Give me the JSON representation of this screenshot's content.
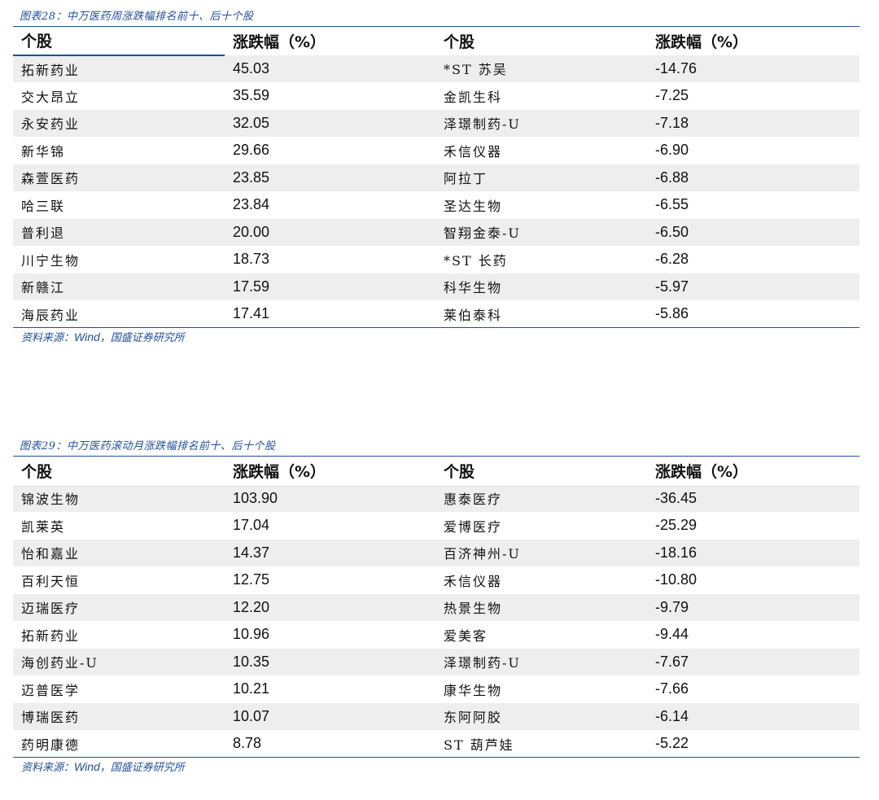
{
  "tables": [
    {
      "title": "图表28：中万医药周涨跌幅排名前十、后十个股",
      "headers": [
        "个股",
        "涨跌幅（%）",
        "个股",
        "涨跌幅（%）"
      ],
      "rows": [
        [
          "拓新药业",
          "45.03",
          "*ST 苏吴",
          "-14.76"
        ],
        [
          "交大昂立",
          "35.59",
          "金凯生科",
          "-7.25"
        ],
        [
          "永安药业",
          "32.05",
          "泽璟制药-U",
          "-7.18"
        ],
        [
          "新华锦",
          "29.66",
          "禾信仪器",
          "-6.90"
        ],
        [
          "森萱医药",
          "23.85",
          "阿拉丁",
          "-6.88"
        ],
        [
          "哈三联",
          "23.84",
          "圣达生物",
          "-6.55"
        ],
        [
          "普利退",
          "20.00",
          "智翔金泰-U",
          "-6.50"
        ],
        [
          "川宁生物",
          "18.73",
          "*ST 长药",
          "-6.28"
        ],
        [
          "新赣江",
          "17.59",
          "科华生物",
          "-5.97"
        ],
        [
          "海辰药业",
          "17.41",
          "莱伯泰科",
          "-5.86"
        ]
      ],
      "source_prefix": "资料来源：",
      "source_wind": "Wind",
      "source_suffix": "，国盛证券研究所"
    },
    {
      "title": "图表29：中万医药滚动月涨跌幅排名前十、后十个股",
      "headers": [
        "个股",
        "涨跌幅（%）",
        "个股",
        "涨跌幅（%）"
      ],
      "rows": [
        [
          "锦波生物",
          "103.90",
          "惠泰医疗",
          "-36.45"
        ],
        [
          "凯莱英",
          "17.04",
          "爱博医疗",
          "-25.29"
        ],
        [
          "怡和嘉业",
          "14.37",
          "百济神州-U",
          "-18.16"
        ],
        [
          "百利天恒",
          "12.75",
          "禾信仪器",
          "-10.80"
        ],
        [
          "迈瑞医疗",
          "12.20",
          "热景生物",
          "-9.79"
        ],
        [
          "拓新药业",
          "10.96",
          "爱美客",
          "-9.44"
        ],
        [
          "海创药业-U",
          "10.35",
          "泽璟制药-U",
          "-7.67"
        ],
        [
          "迈普医学",
          "10.21",
          "康华生物",
          "-7.66"
        ],
        [
          "博瑞医药",
          "10.07",
          "东阿阿胶",
          "-6.14"
        ],
        [
          "药明康德",
          "8.78",
          "ST 葫芦娃",
          "-5.22"
        ]
      ],
      "source_prefix": "资料来源：",
      "source_wind": "Wind",
      "source_suffix": "，国盛证券研究所"
    }
  ]
}
